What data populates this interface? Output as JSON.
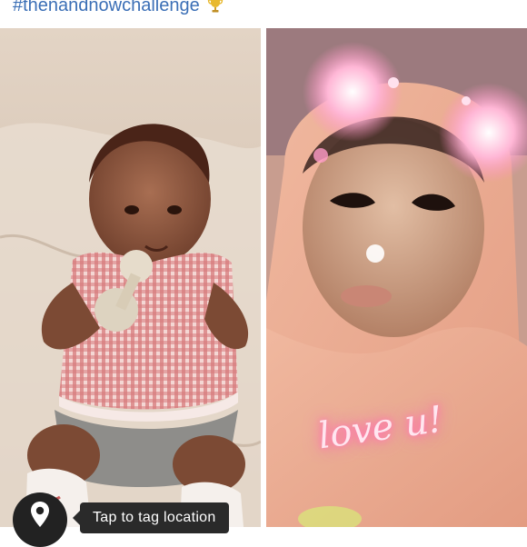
{
  "post": {
    "caption": "#thenandnowchallenge"
  },
  "photos": {
    "left": {
      "label": "baby photo"
    },
    "right": {
      "sticker_text": "love u!"
    }
  },
  "location": {
    "tooltip": "Tap to tag location"
  },
  "colors": {
    "hashtag": "#3b6fb6",
    "tooltip_bg": "#2a2a2a",
    "pin_bg": "#222222"
  },
  "icons": [
    "trophy-icon",
    "location-pin-icon"
  ]
}
